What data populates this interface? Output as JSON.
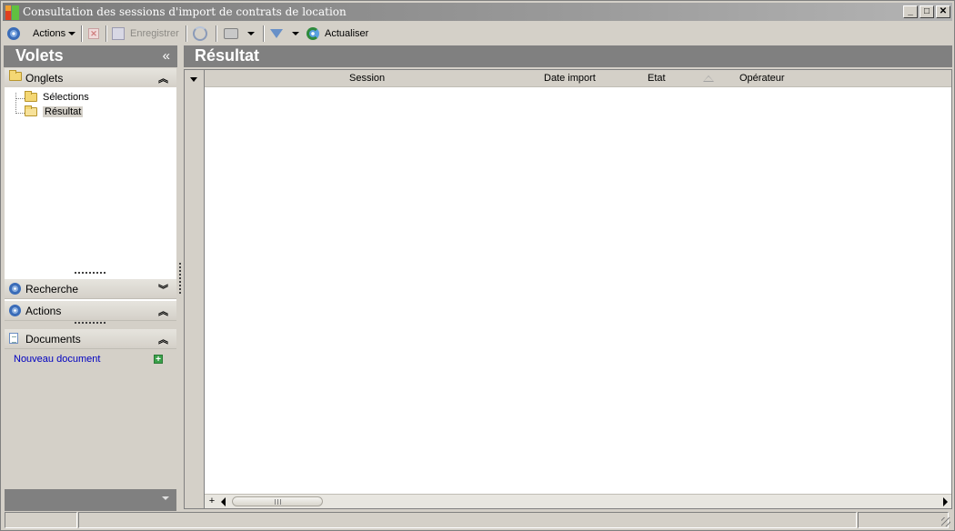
{
  "window": {
    "title": "Consultation des sessions d'import de contrats de location",
    "minimize_glyph": "_",
    "maximize_glyph": "□",
    "close_glyph": "✕"
  },
  "toolbar": {
    "actions_label": "Actions",
    "save_label": "Enregistrer",
    "refresh_label": "Actualiser"
  },
  "left_pane": {
    "title": "Volets",
    "collapse_glyph": "«",
    "sections": {
      "onglets": {
        "label": "Onglets",
        "chevron": "︽"
      },
      "recherche": {
        "label": "Recherche",
        "chevron": "︾"
      },
      "actions": {
        "label": "Actions",
        "chevron": "︽"
      },
      "documents": {
        "label": "Documents",
        "chevron": "︽"
      }
    },
    "tree": [
      {
        "label": "Sélections",
        "selected": false
      },
      {
        "label": "Résultat",
        "selected": true
      }
    ],
    "documents_link": "Nouveau document"
  },
  "result": {
    "title": "Résultat",
    "columns": [
      "Session",
      "Date import",
      "Etat",
      "Opérateur"
    ],
    "sorted_column": "Opérateur",
    "rows": [],
    "add_row_glyph": "+"
  },
  "status": [
    "",
    "",
    ""
  ],
  "colors": {
    "pane_header": "#808080",
    "window_bg": "#d4d0c8",
    "link": "#0000c0"
  }
}
